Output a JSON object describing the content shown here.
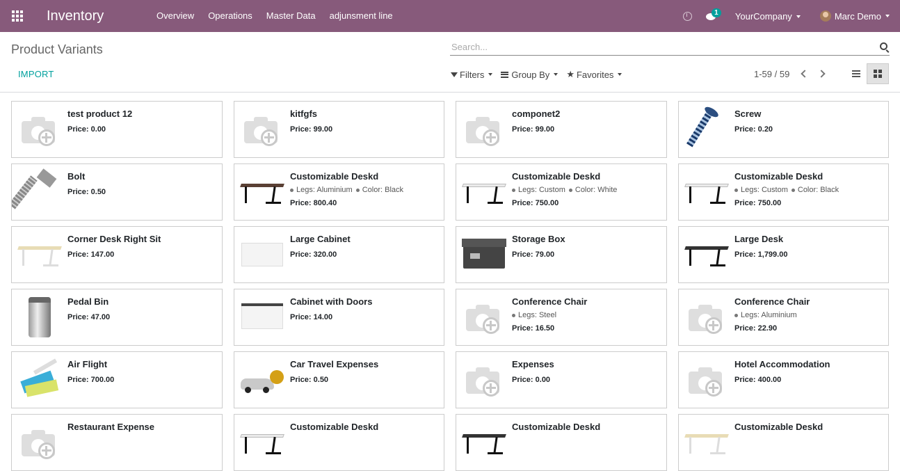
{
  "navbar": {
    "app_name": "Inventory",
    "menu": [
      "Overview",
      "Operations",
      "Master Data",
      "adjunsment line"
    ],
    "chat_badge": "1",
    "company": "YourCompany",
    "user": "Marc Demo",
    "bg_color": "#875a7b"
  },
  "control_panel": {
    "title": "Product Variants",
    "search_placeholder": "Search...",
    "import_label": "IMPORT",
    "filters_label": "Filters",
    "groupby_label": "Group By",
    "favorites_label": "Favorites",
    "pager": "1-59 / 59",
    "accent_color": "#00a09d"
  },
  "cards": [
    {
      "name": "test product 12",
      "price_label": "Price:",
      "price": "0.00",
      "image": "placeholder"
    },
    {
      "name": "kitfgfs",
      "price_label": "Price:",
      "price": "99.00",
      "image": "placeholder"
    },
    {
      "name": "componet2",
      "price_label": "Price:",
      "price": "99.00",
      "image": "placeholder"
    },
    {
      "name": "Screw",
      "price_label": "Price:",
      "price": "0.20",
      "image": "screw"
    },
    {
      "name": "Bolt",
      "price_label": "Price:",
      "price": "0.50",
      "image": "bolt"
    },
    {
      "name": "Customizable Deskd",
      "attrs": [
        "Legs: Aluminium",
        "Color: Black"
      ],
      "price_label": "Price:",
      "price": "800.40",
      "image": "desk-brown"
    },
    {
      "name": "Customizable Deskd",
      "attrs": [
        "Legs: Custom",
        "Color: White"
      ],
      "price_label": "Price:",
      "price": "750.00",
      "image": "desk-white"
    },
    {
      "name": "Customizable Deskd",
      "attrs": [
        "Legs: Custom",
        "Color: Black"
      ],
      "price_label": "Price:",
      "price": "750.00",
      "image": "desk-white"
    },
    {
      "name": "Corner Desk Right Sit",
      "price_label": "Price:",
      "price": "147.00",
      "image": "desk-beige"
    },
    {
      "name": "Large Cabinet",
      "price_label": "Price:",
      "price": "320.00",
      "image": "cabinet"
    },
    {
      "name": "Storage Box",
      "price_label": "Price:",
      "price": "79.00",
      "image": "box"
    },
    {
      "name": "Large Desk",
      "price_label": "Price:",
      "price": "1,799.00",
      "image": "desk-dark"
    },
    {
      "name": "Pedal Bin",
      "price_label": "Price:",
      "price": "47.00",
      "image": "bin"
    },
    {
      "name": "Cabinet with Doors",
      "price_label": "Price:",
      "price": "14.00",
      "image": "cabinet-doors"
    },
    {
      "name": "Conference Chair",
      "attrs": [
        "Legs: Steel"
      ],
      "price_label": "Price:",
      "price": "16.50",
      "image": "placeholder"
    },
    {
      "name": "Conference Chair",
      "attrs": [
        "Legs: Aluminium"
      ],
      "price_label": "Price:",
      "price": "22.90",
      "image": "placeholder"
    },
    {
      "name": "Air Flight",
      "price_label": "Price:",
      "price": "700.00",
      "image": "plane"
    },
    {
      "name": "Car Travel Expenses",
      "price_label": "Price:",
      "price": "0.50",
      "image": "car"
    },
    {
      "name": "Expenses",
      "price_label": "Price:",
      "price": "0.00",
      "image": "placeholder"
    },
    {
      "name": "Hotel Accommodation",
      "price_label": "Price:",
      "price": "400.00",
      "image": "placeholder"
    },
    {
      "name": "Restaurant Expense",
      "price_label": "",
      "price": "",
      "image": "placeholder"
    },
    {
      "name": "Customizable Deskd",
      "price_label": "",
      "price": "",
      "image": "desk-white"
    },
    {
      "name": "Customizable Deskd",
      "price_label": "",
      "price": "",
      "image": "desk-dark"
    },
    {
      "name": "Customizable Deskd",
      "price_label": "",
      "price": "",
      "image": "desk-beige"
    }
  ]
}
